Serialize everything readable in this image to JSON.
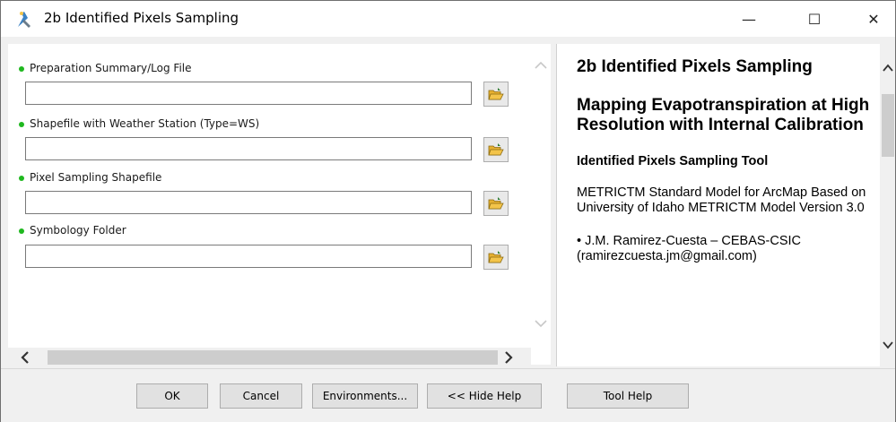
{
  "window": {
    "title": "2b Identified Pixels Sampling",
    "controls": {
      "minimize": "—",
      "maximize": "☐",
      "close": "✕"
    }
  },
  "params": [
    {
      "label": "Preparation Summary/Log File",
      "value": ""
    },
    {
      "label": "Shapefile with Weather Station (Type=WS)",
      "value": ""
    },
    {
      "label": "Pixel Sampling Shapefile",
      "value": ""
    },
    {
      "label": "Symbology Folder",
      "value": ""
    }
  ],
  "help": {
    "title": "2b Identified Pixels Sampling",
    "subtitle": "Mapping Evapotranspiration at High Resolution with Internal Calibration",
    "section": "Identified Pixels Sampling Tool",
    "body": "METRICTM Standard Model for ArcMap Based on University of Idaho METRICTM Model Version 3.0",
    "author": "• J.M. Ramirez-Cuesta – CEBAS-CSIC (ramirezcuesta.jm@gmail.com)"
  },
  "buttons": {
    "ok": "OK",
    "cancel": "Cancel",
    "environments": "Environments...",
    "hide_help": "<< Hide Help",
    "tool_help": "Tool Help"
  },
  "icons": {
    "app": "tool-icon",
    "browse": "open-folder-icon"
  },
  "colors": {
    "required_dot": "#1fb81f",
    "folder_yellow": "#f3c44a"
  }
}
